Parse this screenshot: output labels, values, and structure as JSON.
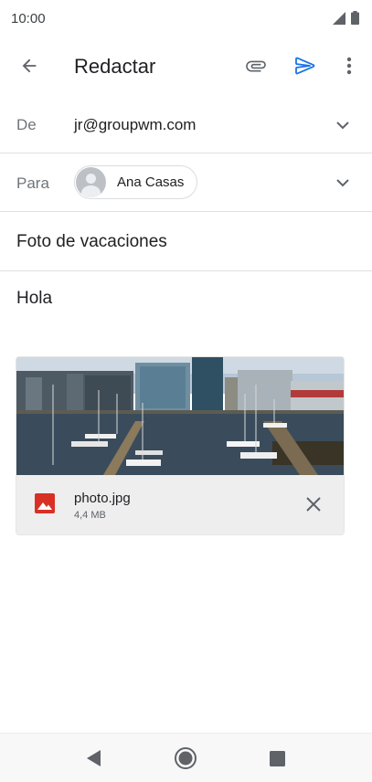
{
  "status_bar": {
    "time": "10:00",
    "icons": [
      "signal-icon",
      "battery-icon"
    ]
  },
  "app_bar": {
    "title": "Redactar",
    "icons": [
      "back-arrow-icon",
      "paperclip-icon",
      "send-icon",
      "more-vert-icon"
    ],
    "send_color": "#1a73e8"
  },
  "from": {
    "label": "De",
    "value": "jr@groupwm.com"
  },
  "to": {
    "label": "Para",
    "recipient": "Ana Casas"
  },
  "subject": "Foto de vacaciones",
  "body": "Hola",
  "attachment": {
    "file_name": "photo.jpg",
    "file_size": "4,4 MB",
    "icon": "image-icon",
    "icon_color": "#d93025"
  },
  "nav_bar": {
    "icons": [
      "back-triangle-icon",
      "home-circle-icon",
      "recents-square-icon"
    ]
  }
}
